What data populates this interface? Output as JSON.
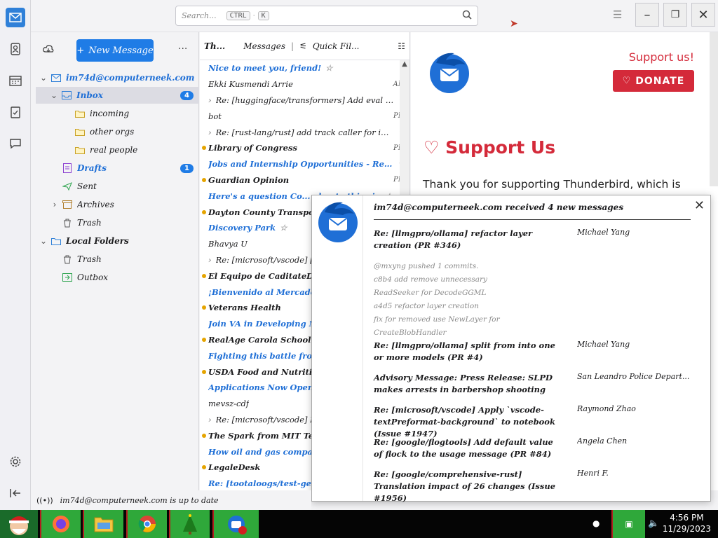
{
  "search": {
    "placeholder": "Search...",
    "shortcut_ctrl": "CTRL",
    "shortcut_key": "K"
  },
  "folder_pane": {
    "new_message": "New Message",
    "account": "im74d@computerneek.com",
    "folders": [
      {
        "name": "Inbox",
        "badge": "4",
        "selected": true,
        "level": 1
      },
      {
        "name": "incoming",
        "level": 2
      },
      {
        "name": "other orgs",
        "level": 2
      },
      {
        "name": "real people",
        "level": 2
      },
      {
        "name": "Drafts",
        "badge": "1",
        "level": 1
      },
      {
        "name": "Sent",
        "level": 1
      },
      {
        "name": "Archives",
        "level": 1
      },
      {
        "name": "Trash",
        "level": 1
      },
      {
        "name": "Local Folders",
        "level": 0
      },
      {
        "name": "Trash",
        "level": 1
      },
      {
        "name": "Outbox",
        "level": 1
      }
    ]
  },
  "list": {
    "col_thread": "Th...",
    "col_messages": "Messages",
    "quick_filter": "Quick Fil...",
    "rows": [
      {
        "text": "Nice to meet you, friend!",
        "style": "subj"
      },
      {
        "text": "Ekki Kusmendi Arrie",
        "meta": "AM",
        "style": "plain"
      },
      {
        "text": "Re: [huggingface/transformers] Add eval lo...",
        "style": "thread"
      },
      {
        "text": "bot",
        "meta": "PM",
        "style": "plain"
      },
      {
        "text": "Re: [rust-lang/rust] add track caller for init...",
        "style": "thread"
      },
      {
        "text": "Library of Congress",
        "meta": "PM",
        "style": "b",
        "dot": true
      },
      {
        "text": "Jobs and Internship Opportunities - Resear...",
        "style": "subj"
      },
      {
        "text": "Guardian Opinion",
        "meta": "PM",
        "style": "b",
        "dot": true
      },
      {
        "text": "Here's a question Co... about ethics in",
        "style": "subj"
      },
      {
        "text": "Dayton County Transportation",
        "style": "b",
        "dot": true
      },
      {
        "text": "Discovery Park",
        "style": "subj"
      },
      {
        "text": "Bhavya U",
        "style": "plain"
      },
      {
        "text": "Re: [microsoft/vscode] [A...",
        "style": "thread"
      },
      {
        "text": "El Equipo de CaditateDeSalud",
        "style": "b",
        "dot": true
      },
      {
        "text": "¡Bienvenido al Mercado Sa...",
        "style": "subj"
      },
      {
        "text": "Veterans Health",
        "style": "b",
        "dot": true
      },
      {
        "text": "Join VA in Developing N...",
        "style": "subj"
      },
      {
        "text": "RealAge Carola School",
        "style": "b",
        "dot": true
      },
      {
        "text": "Fighting this battle from the",
        "style": "subj"
      },
      {
        "text": "USDA Food and Nutrition",
        "style": "b",
        "dot": true
      },
      {
        "text": "Applications Now Open for",
        "style": "subj"
      },
      {
        "text": "mevsz-cdf",
        "style": "plain"
      },
      {
        "text": "Re: [microsoft/vscode] Py...",
        "style": "thread"
      },
      {
        "text": "The Spark from MIT Techn...",
        "style": "b",
        "dot": true
      },
      {
        "text": "How oil and gas compa...",
        "style": "subj"
      },
      {
        "text": "LegaleDesk",
        "style": "b",
        "dot": true
      },
      {
        "text": "Re: [tootaloogs/test-generat...",
        "style": "subj"
      }
    ]
  },
  "reader": {
    "support_link": "Support us!",
    "donate": "DONATE",
    "title": "Support Us",
    "body": "Thank you for supporting Thunderbird, which is"
  },
  "notification": {
    "title": "im74d@computerneek.com received 4 new messages",
    "items": [
      {
        "subject": "Re: [llmgpro/ollama] refactor layer creation (PR #346)",
        "from": "Michael Yang"
      },
      {
        "subject": "Re: [llmgpro/ollama] split from into one or more models (PR #4)",
        "from": "Michael Yang"
      },
      {
        "subject": "Advisory Message: Press Release: SLPD makes arrests in barbershop shooting",
        "from": "San Leandro Police Depart..."
      },
      {
        "subject": "Re: [microsoft/vscode] Apply `vscode-textPreformat-background` to notebook (Issue #1947)",
        "from": "Raymond Zhao"
      },
      {
        "subject": "Re: [google/flogtools] Add default value of flock to the usage message (PR #84)",
        "from": "Angela Chen"
      },
      {
        "subject": "Re: [google/comprehensive-rust] Translation impact of 26 changes (Issue #1956)",
        "from": "Henri F."
      }
    ],
    "excerpt": [
      "@mxyng pushed 1 commits.",
      "c8b4 add remove unnecessary",
      "ReadSeeker for DecodeGGML",
      "a4d5 refactor layer creation",
      "fix for removed use NewLayer for",
      "CreateBlobHandler"
    ]
  },
  "status": {
    "text": "im74d@computerneek.com is up to date"
  },
  "clock": {
    "time": "4:56 PM",
    "date": "11/29/2023"
  },
  "colors": {
    "accent": "#1f7ce6",
    "donate": "#d42a3a",
    "taskbar_green": "#2fa83a"
  }
}
